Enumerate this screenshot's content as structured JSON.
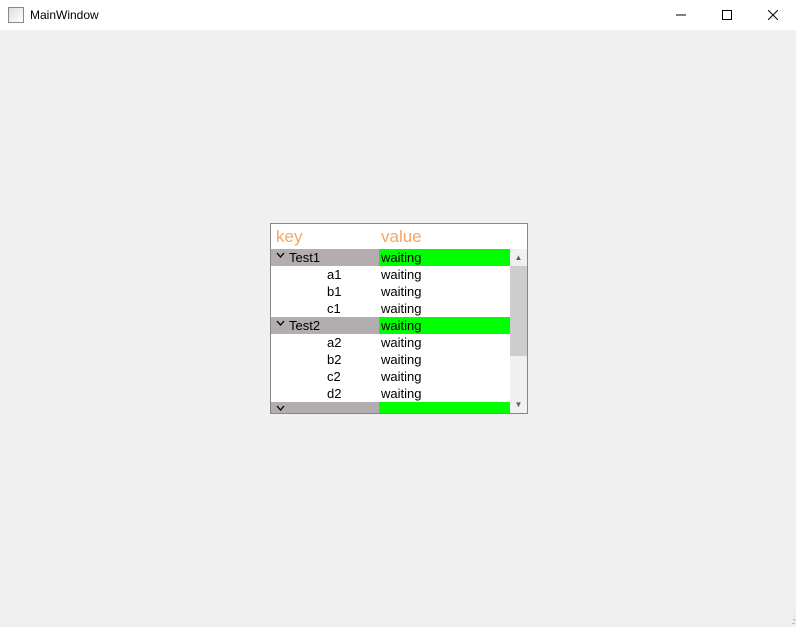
{
  "window": {
    "title": "MainWindow"
  },
  "tree": {
    "headers": {
      "key": "key",
      "value": "value"
    },
    "rows": [
      {
        "type": "parent",
        "expanded": true,
        "key": "Test1",
        "value": "waiting"
      },
      {
        "type": "child",
        "key": "a1",
        "value": "waiting"
      },
      {
        "type": "child",
        "key": "b1",
        "value": "waiting"
      },
      {
        "type": "child",
        "key": "c1",
        "value": "waiting"
      },
      {
        "type": "parent",
        "expanded": true,
        "key": "Test2",
        "value": "waiting"
      },
      {
        "type": "child",
        "key": "a2",
        "value": "waiting"
      },
      {
        "type": "child",
        "key": "b2",
        "value": "waiting"
      },
      {
        "type": "child",
        "key": "c2",
        "value": "waiting"
      },
      {
        "type": "child",
        "key": "d2",
        "value": "waiting"
      },
      {
        "type": "parent",
        "expanded": true,
        "key": "",
        "value": ""
      }
    ]
  }
}
